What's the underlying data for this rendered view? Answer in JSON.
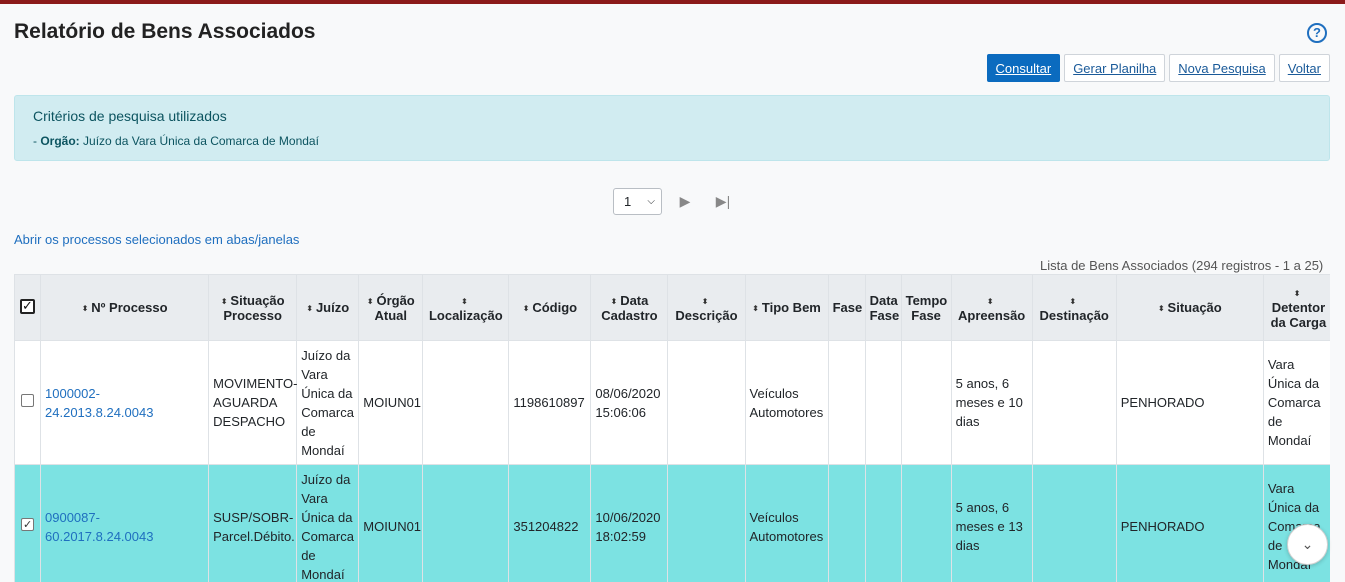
{
  "page": {
    "title": "Relatório de Bens Associados",
    "help_icon": "?"
  },
  "actions": {
    "consultar": "Consultar",
    "gerar_planilha": "Gerar Planilha",
    "nova_pesquisa": "Nova Pesquisa",
    "voltar": "Voltar"
  },
  "criteria": {
    "title": "Critérios de pesquisa utilizados",
    "prefix": "- ",
    "label": "Orgão:",
    "value": "Juízo da Vara Única da Comarca de Mondaí"
  },
  "pager": {
    "current_page": "1",
    "next_icon": "▶",
    "last_icon": "▶|"
  },
  "open_selected_link": "Abrir os processos selecionados em abas/janelas",
  "list_caption": "Lista de Bens Associados (294 registros - 1 a 25)",
  "table": {
    "header_checked": true,
    "columns": [
      "Nº Processo",
      "Situação Processo",
      "Juízo",
      "Órgão Atual",
      "Localização",
      "Código",
      "Data Cadastro",
      "Descrição",
      "Tipo Bem",
      "Fase",
      "Data Fase",
      "Tempo Fase",
      "Apreensão",
      "Destinação",
      "Situação",
      "Detentor da Carga"
    ],
    "rows": [
      {
        "checked": false,
        "processo": "1000002-24.2013.8.24.0043",
        "situacao_processo": "MOVIMENTO-AGUARDA DESPACHO",
        "juizo": "Juízo da Vara Única da Comarca de Mondaí",
        "orgao_atual": "MOIUN01",
        "localizacao": "",
        "codigo": "1198610897",
        "data_cadastro": "08/06/2020 15:06:06",
        "descricao": "",
        "tipo_bem": "Veículos Automotores",
        "fase": "",
        "data_fase": "",
        "tempo_fase": "",
        "apreensao": "5 anos, 6 meses e 10 dias",
        "destinacao": "",
        "situacao": "PENHORADO",
        "detentor": "Vara Única da Comarca de Mondaí"
      },
      {
        "checked": true,
        "processo": "0900087-60.2017.8.24.0043",
        "situacao_processo": "SUSP/SOBR-Parcel.Débito.",
        "juizo": "Juízo da Vara Única da Comarca de Mondaí",
        "orgao_atual": "MOIUN01",
        "localizacao": "",
        "codigo": "351204822",
        "data_cadastro": "10/06/2020 18:02:59",
        "descricao": "",
        "tipo_bem": "Veículos Automotores",
        "fase": "",
        "data_fase": "",
        "tempo_fase": "",
        "apreensao": "5 anos, 6 meses e 13 dias",
        "destinacao": "",
        "situacao": "PENHORADO",
        "detentor": "Vara Única da Comarca de Mondaí"
      }
    ]
  }
}
